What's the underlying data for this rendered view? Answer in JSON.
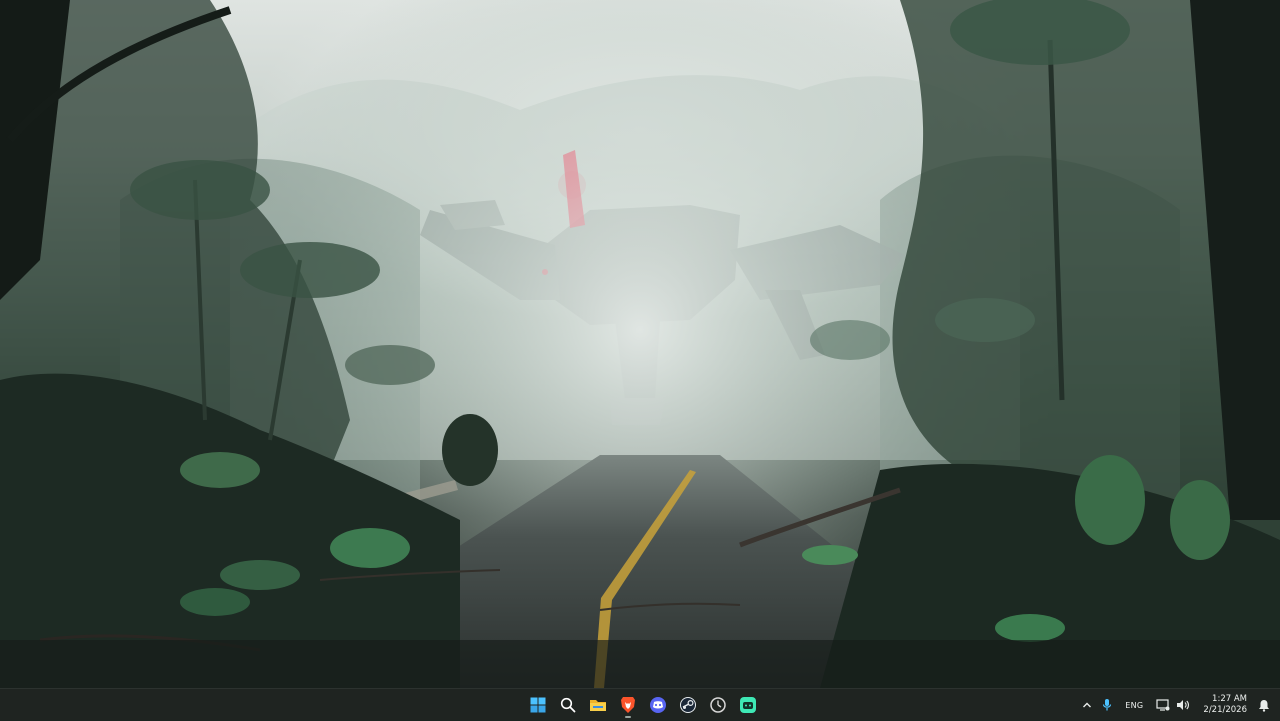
{
  "taskbar": {
    "apps": [
      {
        "id": "start",
        "icon": "windows-start-icon",
        "accent": "#4cc2ff",
        "active": false
      },
      {
        "id": "search",
        "icon": "search-icon",
        "accent": "#ffffff",
        "active": false
      },
      {
        "id": "file-explorer",
        "icon": "folder-icon",
        "accent": "#f5c842",
        "active": false
      },
      {
        "id": "brave",
        "icon": "brave-lion-icon",
        "accent": "#fb542b",
        "active": true
      },
      {
        "id": "discord",
        "icon": "discord-icon",
        "accent": "#5865f2",
        "active": false
      },
      {
        "id": "steam",
        "icon": "steam-icon",
        "accent": "#1b2838",
        "active": false
      },
      {
        "id": "clock-app",
        "icon": "stopwatch-icon",
        "accent": "#d8d8d8",
        "active": false
      },
      {
        "id": "game-app",
        "icon": "gamepad-icon",
        "accent": "#3ee8b5",
        "active": false
      }
    ],
    "tray": {
      "language": "ENG",
      "time": "1:27 AM",
      "date": "2/21/2026"
    }
  },
  "wallpaper": {
    "colors": {
      "sky": "#e8ecea",
      "fog": "#b9c6bf",
      "jungle": "#2e3f35",
      "road": "#3a4140",
      "lane-line": "#c9a23a",
      "robot-glow": "#ff3a5a"
    }
  }
}
